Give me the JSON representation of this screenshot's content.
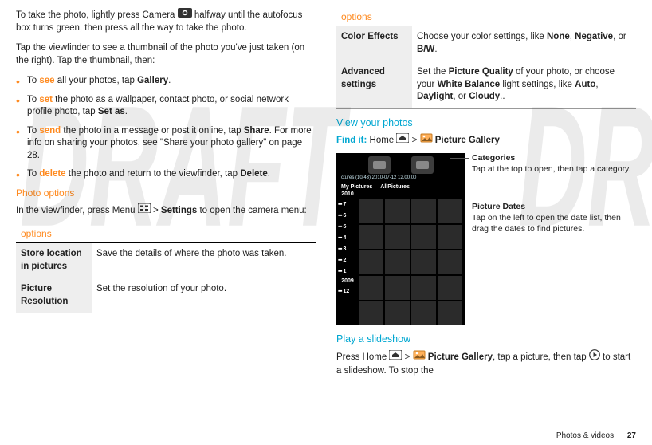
{
  "watermark": "DRAFT",
  "left": {
    "para1_a": "To take the photo, lightly press Camera ",
    "para1_b": " halfway until the autofocus box turns green, then press all the way to take the photo.",
    "para2": "Tap the viewfinder to see a thumbnail of the photo you've just taken (on the right). Tap the thumbnail, then:",
    "b1_a": "To ",
    "b1_k": "see",
    "b1_b": " all your photos, tap ",
    "b1_c": "Gallery",
    "b1_d": ".",
    "b2_a": "To ",
    "b2_k": "set",
    "b2_b": " the photo as a wallpaper, contact photo, or social network profile photo, tap ",
    "b2_c": "Set as",
    "b2_d": ".",
    "b3_a": "To ",
    "b3_k": "send",
    "b3_b": " the photo in a message or post it online, tap ",
    "b3_c": "Share",
    "b3_d": ". For more info on sharing your photos, see \"Share your photo gallery\" on page 28.",
    "b4_a": "To ",
    "b4_k": "delete",
    "b4_b": " the photo and return to the viewfinder, tap ",
    "b4_c": "Delete",
    "b4_d": ".",
    "h_photo_options": "Photo options",
    "para3_a": "In the viewfinder, press Menu ",
    "para3_b": " > ",
    "para3_c": "Settings",
    "para3_d": " to open the camera menu:",
    "opt_header": "options",
    "r1k": "Store location in pictures",
    "r1v": "Save the details of where the photo was taken.",
    "r2k": "Picture Resolution",
    "r2v": "Set the resolution of your photo."
  },
  "right": {
    "opt_header": "options",
    "r3k": "Color Effects",
    "r3v_a": "Choose your color settings, like ",
    "r3v_b": "None",
    "r3v_c": ", ",
    "r3v_d": "Negative",
    "r3v_e": ", or ",
    "r3v_f": "B/W",
    "r3v_g": ".",
    "r4k": "Advanced settings",
    "r4v_a": "Set the ",
    "r4v_b": "Picture Quality",
    "r4v_c": " of your photo, or choose your ",
    "r4v_d": "White Balance",
    "r4v_e": " light settings, like ",
    "r4v_f": "Auto",
    "r4v_g": ", ",
    "r4v_h": "Daylight",
    "r4v_i": ", or ",
    "r4v_j": "Cloudy",
    "r4v_k": "..",
    "h_view": "View your photos",
    "find_label": "Find it:",
    "find_a": " Home ",
    "find_b": " > ",
    "find_c": " Picture Gallery",
    "phone": {
      "toprow": "ctures (10/43)    2010-07-12  12.00.00",
      "tab1": "My Pictures",
      "tab2": "AllPictures",
      "y1": "2010",
      "m7": "7",
      "m6": "6",
      "m5": "5",
      "m4": "4",
      "m3": "3",
      "m2": "2",
      "m1": "1",
      "y2": "2009",
      "m12": "12"
    },
    "co1_t": "Categories",
    "co1_b": "Tap at the top to open, then tap a category.",
    "co2_t": "Picture Dates",
    "co2_b": "Tap on the left to open the date list, then drag the dates to find pictures.",
    "h_play": "Play a slideshow",
    "play_a": "Press Home ",
    "play_b": " > ",
    "play_c": " Picture Gallery",
    "play_d": ", tap a picture, then tap ",
    "play_e": " to start a slideshow. To stop the"
  },
  "footer": {
    "section": "Photos & videos",
    "page": "27"
  }
}
